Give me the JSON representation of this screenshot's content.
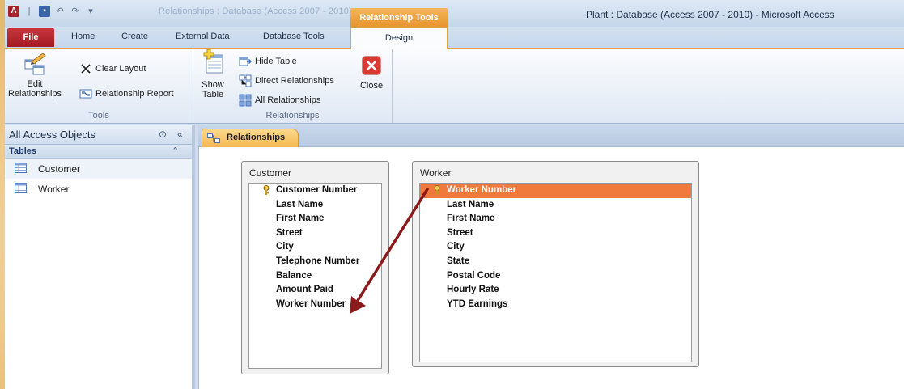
{
  "window": {
    "title": "Plant : Database (Access 2007 - 2010)  -  Microsoft Access",
    "faded_title": "Relationships : Database (Access 2007 - 2010)",
    "contextual_header": "Relationship Tools"
  },
  "ribbon": {
    "tabs": [
      {
        "label": "File"
      },
      {
        "label": "Home"
      },
      {
        "label": "Create"
      },
      {
        "label": "External Data"
      },
      {
        "label": "Database Tools"
      },
      {
        "label": "Design"
      }
    ],
    "groups": {
      "tools": {
        "label": "Tools",
        "edit_relationships": "Edit\nRelationships",
        "clear_layout": "Clear Layout",
        "relationship_report": "Relationship Report"
      },
      "relationships": {
        "label": "Relationships",
        "show_table": "Show\nTable",
        "hide_table": "Hide Table",
        "direct_relationships": "Direct Relationships",
        "all_relationships": "All Relationships",
        "close": "Close"
      }
    }
  },
  "nav_pane": {
    "title": "All Access Objects",
    "section": "Tables",
    "items": [
      {
        "label": "Customer"
      },
      {
        "label": "Worker"
      }
    ]
  },
  "document": {
    "tab_label": "Relationships"
  },
  "tables": {
    "customer": {
      "title": "Customer",
      "fields": [
        "Customer Number",
        "Last Name",
        "First Name",
        "Street",
        "City",
        "Telephone Number",
        "Balance",
        "Amount Paid",
        "Worker Number"
      ]
    },
    "worker": {
      "title": "Worker",
      "fields": [
        "Worker Number",
        "Last Name",
        "First Name",
        "Street",
        "City",
        "State",
        "Postal Code",
        "Hourly Rate",
        "YTD Earnings"
      ]
    }
  },
  "colors": {
    "accent_orange": "#f07a3c",
    "arrow": "#8b1a1a",
    "file_tab": "#b52830",
    "contextual_tab": "#ec9f3e"
  }
}
